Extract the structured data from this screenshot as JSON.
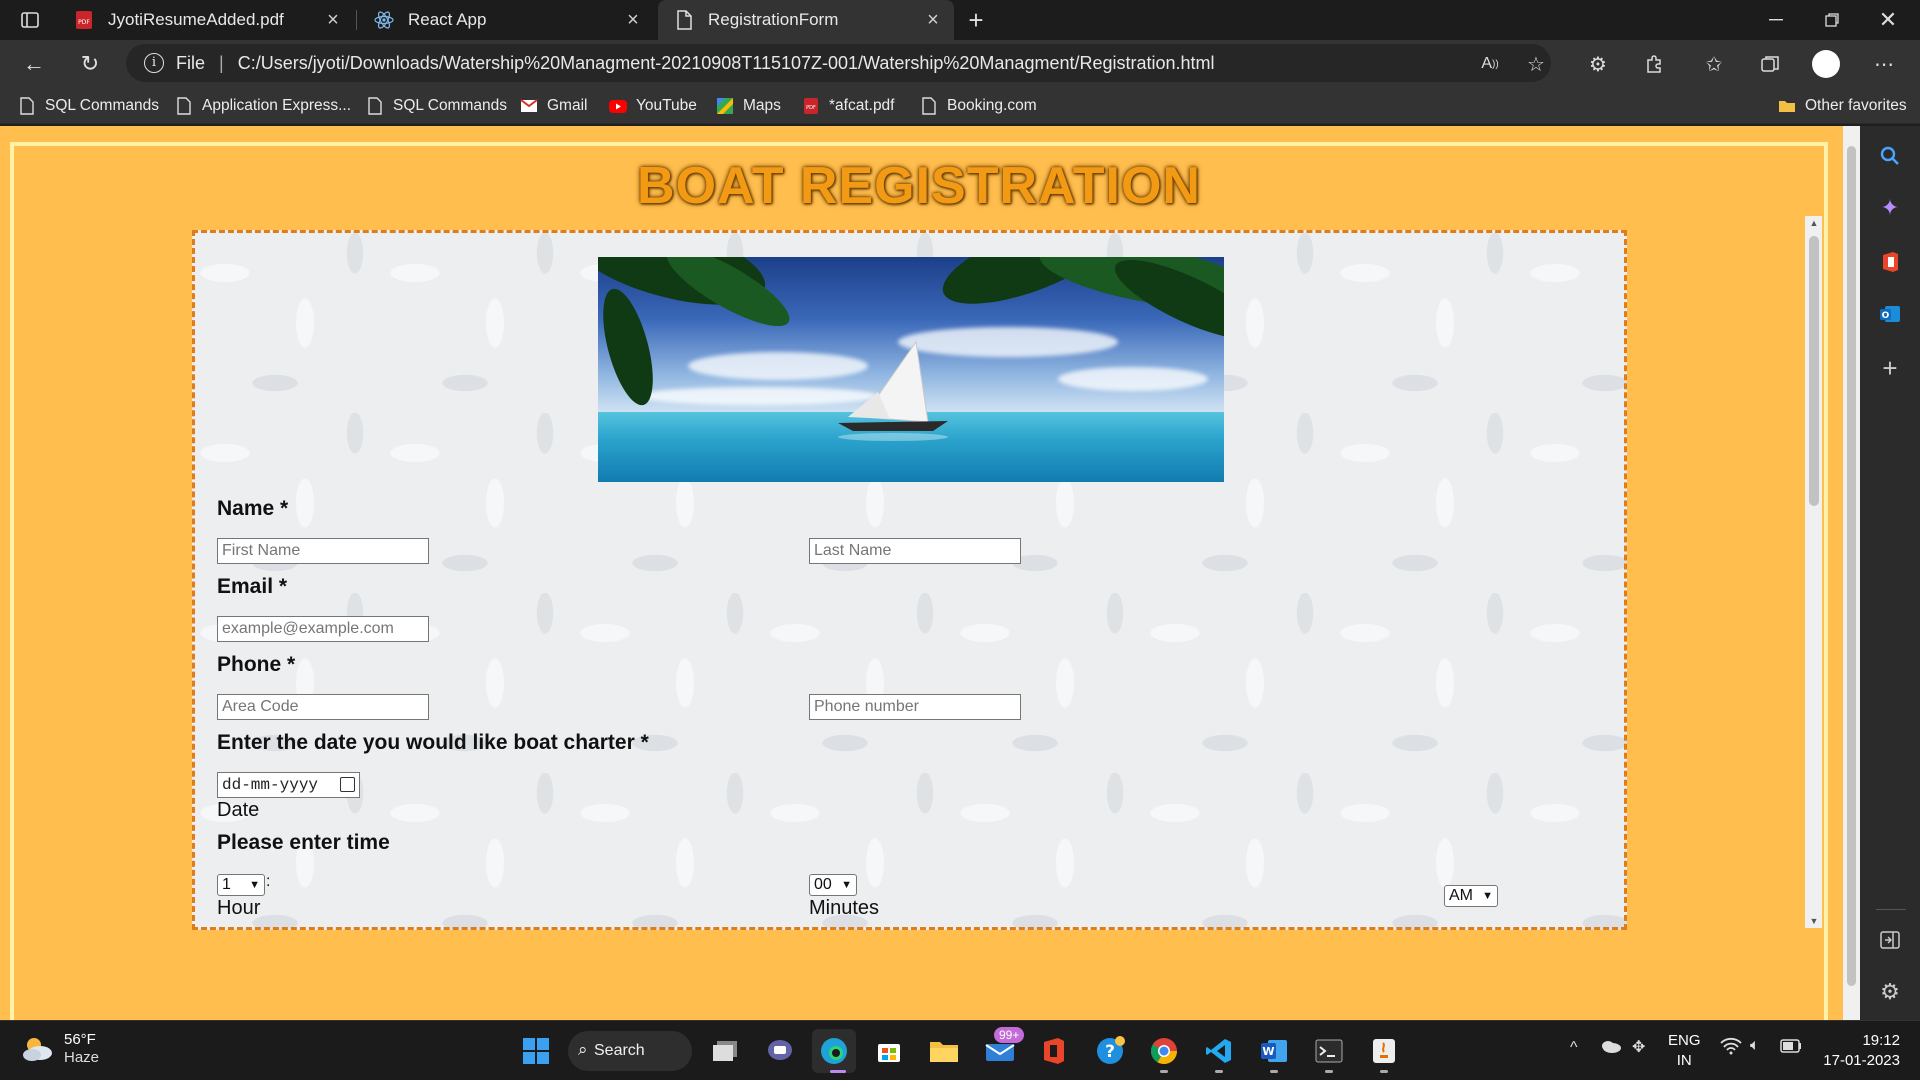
{
  "browser": {
    "tabs": [
      {
        "title": "JyotiResumeAdded.pdf",
        "icon": "pdf-icon",
        "active": false
      },
      {
        "title": "React App",
        "icon": "react-icon",
        "active": false
      },
      {
        "title": "RegistrationForm",
        "icon": "page-icon",
        "active": true
      }
    ],
    "address": {
      "scheme_label": "File",
      "url": "C:/Users/jyoti/Downloads/Watership%20Managment-20210908T115107Z-001/Watership%20Managment/Registration.html"
    },
    "bookmarks": [
      {
        "label": "SQL Commands",
        "icon": "page-icon"
      },
      {
        "label": "Application Express...",
        "icon": "page-icon"
      },
      {
        "label": "SQL Commands",
        "icon": "page-icon"
      },
      {
        "label": "Gmail",
        "icon": "gmail-icon"
      },
      {
        "label": "YouTube",
        "icon": "youtube-icon"
      },
      {
        "label": "Maps",
        "icon": "maps-icon"
      },
      {
        "label": "*afcat.pdf",
        "icon": "pdf-icon"
      },
      {
        "label": "Booking.com",
        "icon": "page-icon"
      }
    ],
    "other_favorites": "Other favorites"
  },
  "page": {
    "title": "BOAT REGISTRATION",
    "form": {
      "name_label": "Name *",
      "first_name_placeholder": "First Name",
      "last_name_placeholder": "Last Name",
      "email_label": "Email *",
      "email_placeholder": "example@example.com",
      "phone_label": "Phone *",
      "area_code_placeholder": "Area Code",
      "phone_number_placeholder": "Phone number",
      "date_label": "Enter the date you would like boat charter *",
      "date_value": "dd-mm-yyyy",
      "date_sublabel": "Date",
      "time_label": "Please enter time",
      "hour_value": "1",
      "hour_colon": ":",
      "hour_sublabel": "Hour",
      "minutes_value": "00",
      "minutes_sublabel": "Minutes",
      "ampm_value": "AM"
    }
  },
  "taskbar": {
    "weather": {
      "temp": "56°F",
      "condition": "Haze"
    },
    "search_label": "Search",
    "mail_badge": "99+",
    "language": "ENG",
    "region": "IN",
    "time": "19:12",
    "date": "17-01-2023"
  },
  "colors": {
    "page_background": "#ffbe4e",
    "title_color": "#f39a14",
    "card_border": "#e07d1a"
  }
}
